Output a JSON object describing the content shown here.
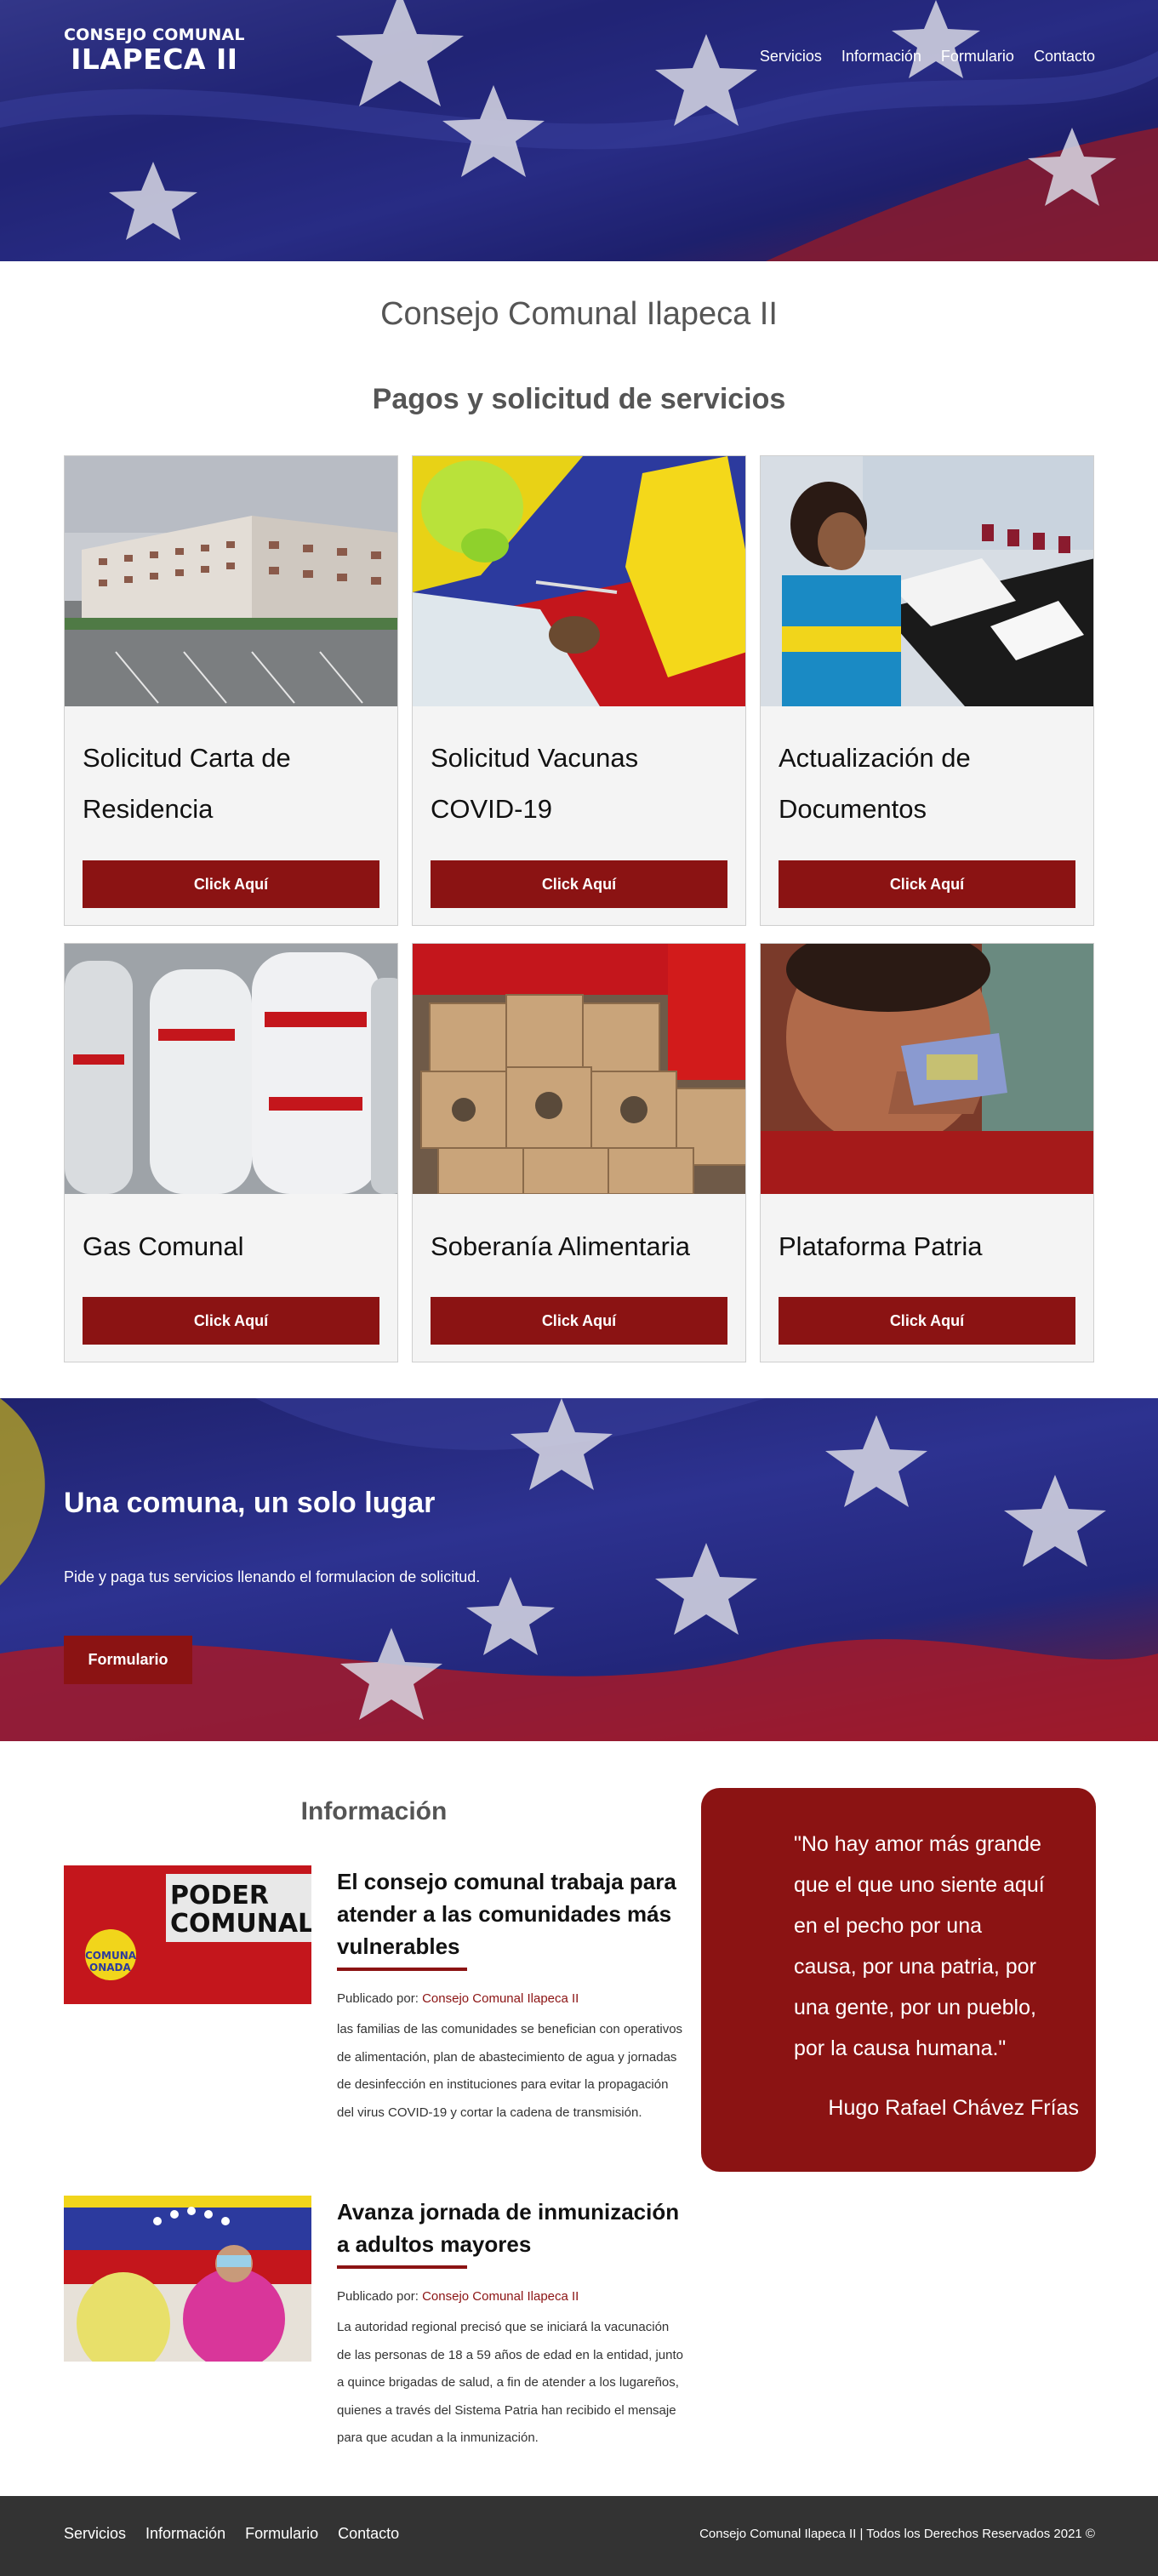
{
  "header": {
    "logo_line1": "CONSEJO COMUNAL",
    "logo_line2": "ILAPECA II",
    "nav": [
      "Servicios",
      "Información",
      "Formulario",
      "Contacto"
    ]
  },
  "main": {
    "site_title": "Consejo Comunal Ilapeca II",
    "section_title": "Pagos y solicitud de servicios",
    "cards": [
      {
        "title": "Solicitud Carta de Residencia",
        "button": "Click Aquí",
        "image": "apartment-buildings"
      },
      {
        "title": "Solicitud Vacunas COVID-19",
        "button": "Click Aquí",
        "image": "vaccination"
      },
      {
        "title": "Actualización de Documentos",
        "button": "Click Aquí",
        "image": "office-meeting"
      },
      {
        "title": "Gas Comunal",
        "button": "Click Aquí",
        "image": "gas-cylinders"
      },
      {
        "title": "Soberanía Alimentaria",
        "button": "Click Aquí",
        "image": "food-boxes"
      },
      {
        "title": "Plataforma Patria",
        "button": "Click Aquí",
        "image": "patria-card"
      }
    ]
  },
  "banner": {
    "heading": "Una comuna, un solo lugar",
    "text": "Pide y paga tus servicios llenando el formulacion de solicitud.",
    "button": "Formulario"
  },
  "info": {
    "title": "Información",
    "articles": [
      {
        "title": "El consejo comunal trabaja para atender a las comunidades más vulnerables",
        "byline_prefix": "Publicado por: ",
        "author": "Consejo Comunal Ilapeca II",
        "excerpt": "las familias de las comunidades se benefician con operativos de alimentación, plan de abastecimiento de agua y jornadas de desinfección en instituciones para evitar la propagación del virus COVID-19 y cortar la cadena de transmisión.",
        "thumb_text1": "PODER",
        "thumb_text2": "COMUNAL",
        "thumb_text3": "COMUNA",
        "thumb_text4": "ONADA"
      },
      {
        "title": "Avanza jornada de inmunización a adultos mayores",
        "byline_prefix": "Publicado por: ",
        "author": "Consejo Comunal Ilapeca II",
        "excerpt": "La autoridad regional precisó que se iniciará la vacunación de las personas de 18 a 59 años de edad en la entidad, junto a quince brigadas de salud, a fin de atender a los lugareños, quienes a través del Sistema Patria han recibido el mensaje para que acudan a la inmunización."
      }
    ],
    "quote": "\"No hay amor más grande que el que uno siente aquí en el pecho por una causa, por una patria, por una gente, por un pueblo, por la causa humana.\"",
    "quote_author": "Hugo Rafael Chávez Frías"
  },
  "footer": {
    "nav": [
      "Servicios",
      "Información",
      "Formulario",
      "Contacto"
    ],
    "copyright": "Consejo Comunal Ilapeca II | Todos los Derechos Reservados 2021 ©"
  },
  "colors": {
    "accent": "#8b1313",
    "footer_bg": "#333333",
    "card_bg": "#f4f4f4",
    "flag_blue": "#25297f"
  }
}
